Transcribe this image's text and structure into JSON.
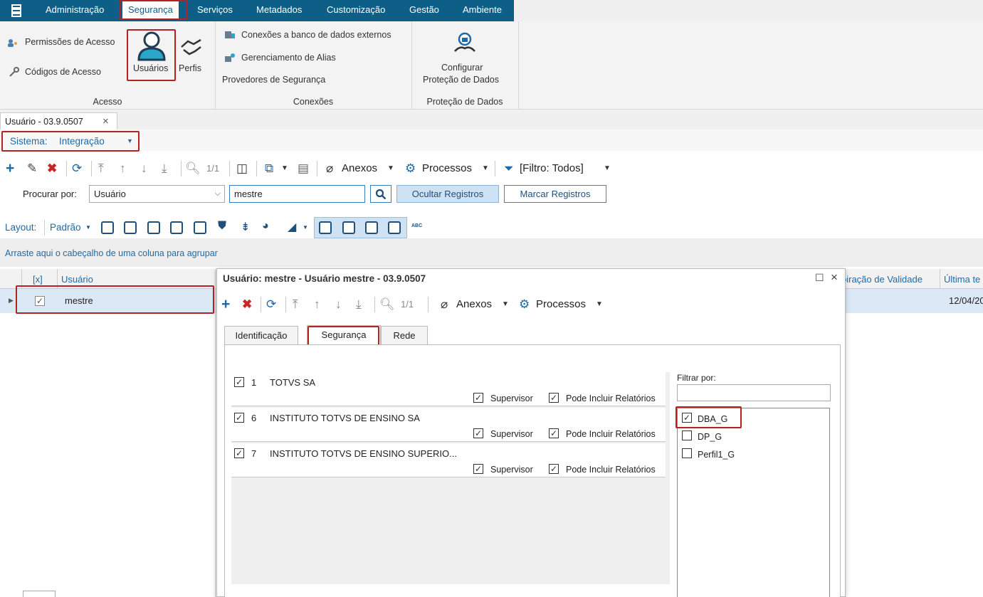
{
  "menu": {
    "items": [
      {
        "id": "administracao",
        "label": "Administração"
      },
      {
        "id": "seguranca",
        "label": "Segurança"
      },
      {
        "id": "servicos",
        "label": "Serviços"
      },
      {
        "id": "metadados",
        "label": "Metadados"
      },
      {
        "id": "customizacao",
        "label": "Customização"
      },
      {
        "id": "gestao",
        "label": "Gestão"
      },
      {
        "id": "ambiente",
        "label": "Ambiente"
      }
    ]
  },
  "ribbon": {
    "permissoes": "Permissões de Acesso",
    "codigos": "Códigos de Acesso",
    "usuarios": "Usuários",
    "perfis": "Perfis",
    "grupo_acesso": "Acesso",
    "conexoes_externos": "Conexões a banco de dados externos",
    "gerenciamento_alias": "Gerenciamento de Alias",
    "provedores": "Provedores de Segurança",
    "grupo_conexoes": "Conexões",
    "configurar_line1": "Configurar",
    "configurar_line2": "Proteção de Dados",
    "grupo_protecao": "Proteção de Dados"
  },
  "doc_tab": {
    "label": "Usuário - 03.9.0507",
    "close": "×"
  },
  "sistema": {
    "label": "Sistema:",
    "value": "Integração"
  },
  "toolbar": {
    "paging": "1/1",
    "anexos": "Anexos",
    "processos": "Processos",
    "filtro": "[Filtro: Todos]"
  },
  "search": {
    "procurar_label": "Procurar por:",
    "field": "Usuário",
    "value": "mestre",
    "ocultar": "Ocultar Registros",
    "marcar": "Marcar Registros"
  },
  "layout_bar": {
    "label": "Layout:",
    "padrao": "Padrão",
    "abc": "ABC"
  },
  "group_hint": "Arraste aqui o cabeçalho de uma coluna para agrupar",
  "grid": {
    "col_check": "[x]",
    "col_usuario": "Usuário",
    "col_expiracao": "piração de Validade",
    "col_ultima": "Última te",
    "row_usuario": "mestre",
    "row_ultima": "12/04/20"
  },
  "dialog": {
    "title": "Usuário: mestre - Usuário mestre - 03.9.0507",
    "paging": "1/1",
    "anexos": "Anexos",
    "processos": "Processos",
    "tabs": [
      "Identificação",
      "Segurança",
      "Rede"
    ],
    "companies": [
      {
        "code": "1",
        "name": "TOTVS SA"
      },
      {
        "code": "6",
        "name": "INSTITUTO TOTVS DE ENSINO SA"
      },
      {
        "code": "7",
        "name": "INSTITUTO TOTVS DE ENSINO SUPERIO..."
      }
    ],
    "supervisor": "Supervisor",
    "pode_incluir": "Pode Incluir Relatórios",
    "filtrar_por": "Filtrar por:",
    "perfis": [
      {
        "name": "DBA_G",
        "checked": true
      },
      {
        "name": "DP_G",
        "checked": false
      },
      {
        "name": "Perfil1_G",
        "checked": false
      }
    ]
  },
  "colors": {
    "menubar": "#0e5f88",
    "highlight": "#b32323",
    "accent": "#1f6aa5"
  }
}
